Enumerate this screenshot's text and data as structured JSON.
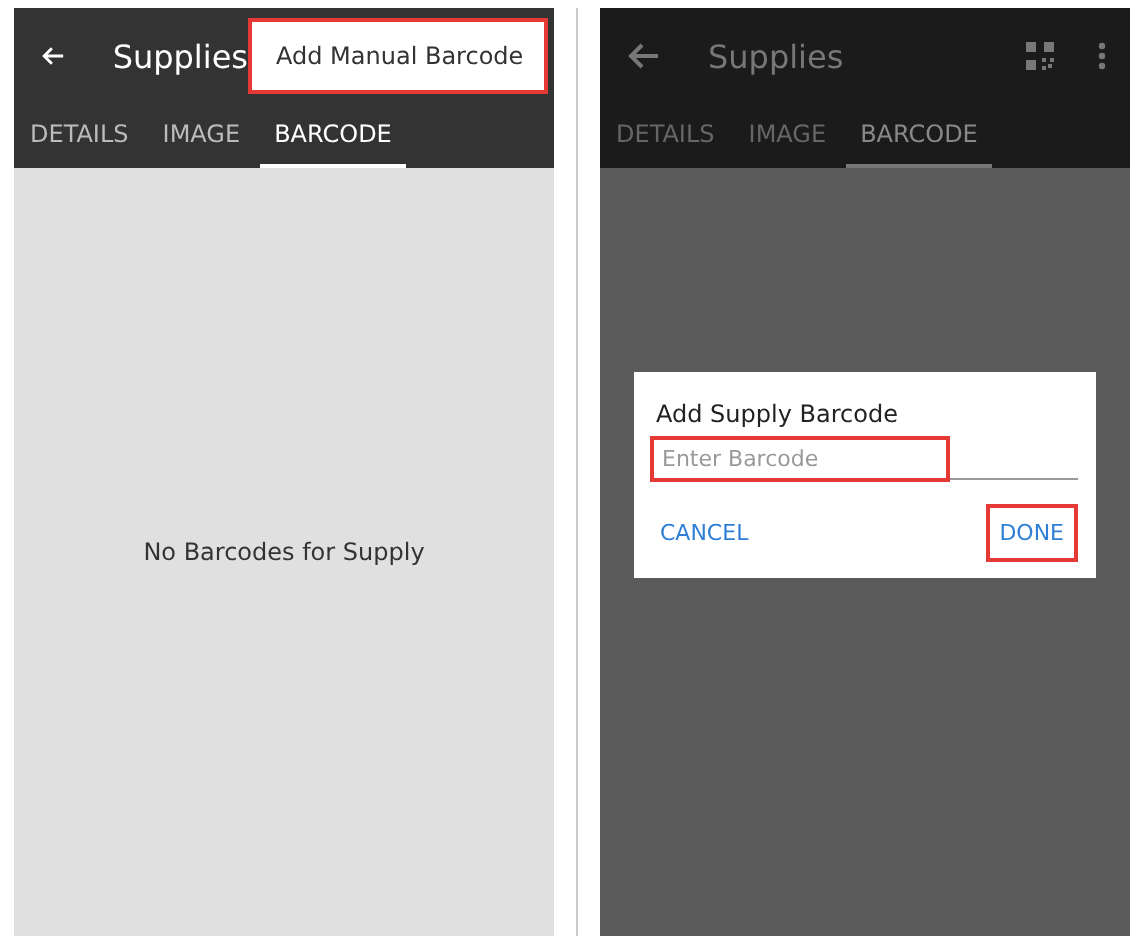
{
  "screens": [
    {
      "kind": "list",
      "title": "Supplies",
      "menu_popup": {
        "label": "Add Manual Barcode",
        "highlighted": true
      },
      "tabs": [
        {
          "label": "DETAILS",
          "selected": false
        },
        {
          "label": "IMAGE",
          "selected": false
        },
        {
          "label": "BARCODE",
          "selected": true
        }
      ],
      "empty_message": "No Barcodes for  Supply"
    },
    {
      "kind": "dialog",
      "title": "Supplies",
      "tabs": [
        {
          "label": "DETAILS",
          "selected": false
        },
        {
          "label": "IMAGE",
          "selected": false
        },
        {
          "label": "BARCODE",
          "selected": true
        }
      ],
      "dialog": {
        "title": "Add  Supply Barcode",
        "field": {
          "placeholder": "Enter Barcode",
          "highlighted": true
        },
        "buttons": [
          {
            "label": "CANCEL",
            "highlighted": false
          },
          {
            "label": "DONE",
            "highlighted": true
          }
        ]
      }
    }
  ]
}
